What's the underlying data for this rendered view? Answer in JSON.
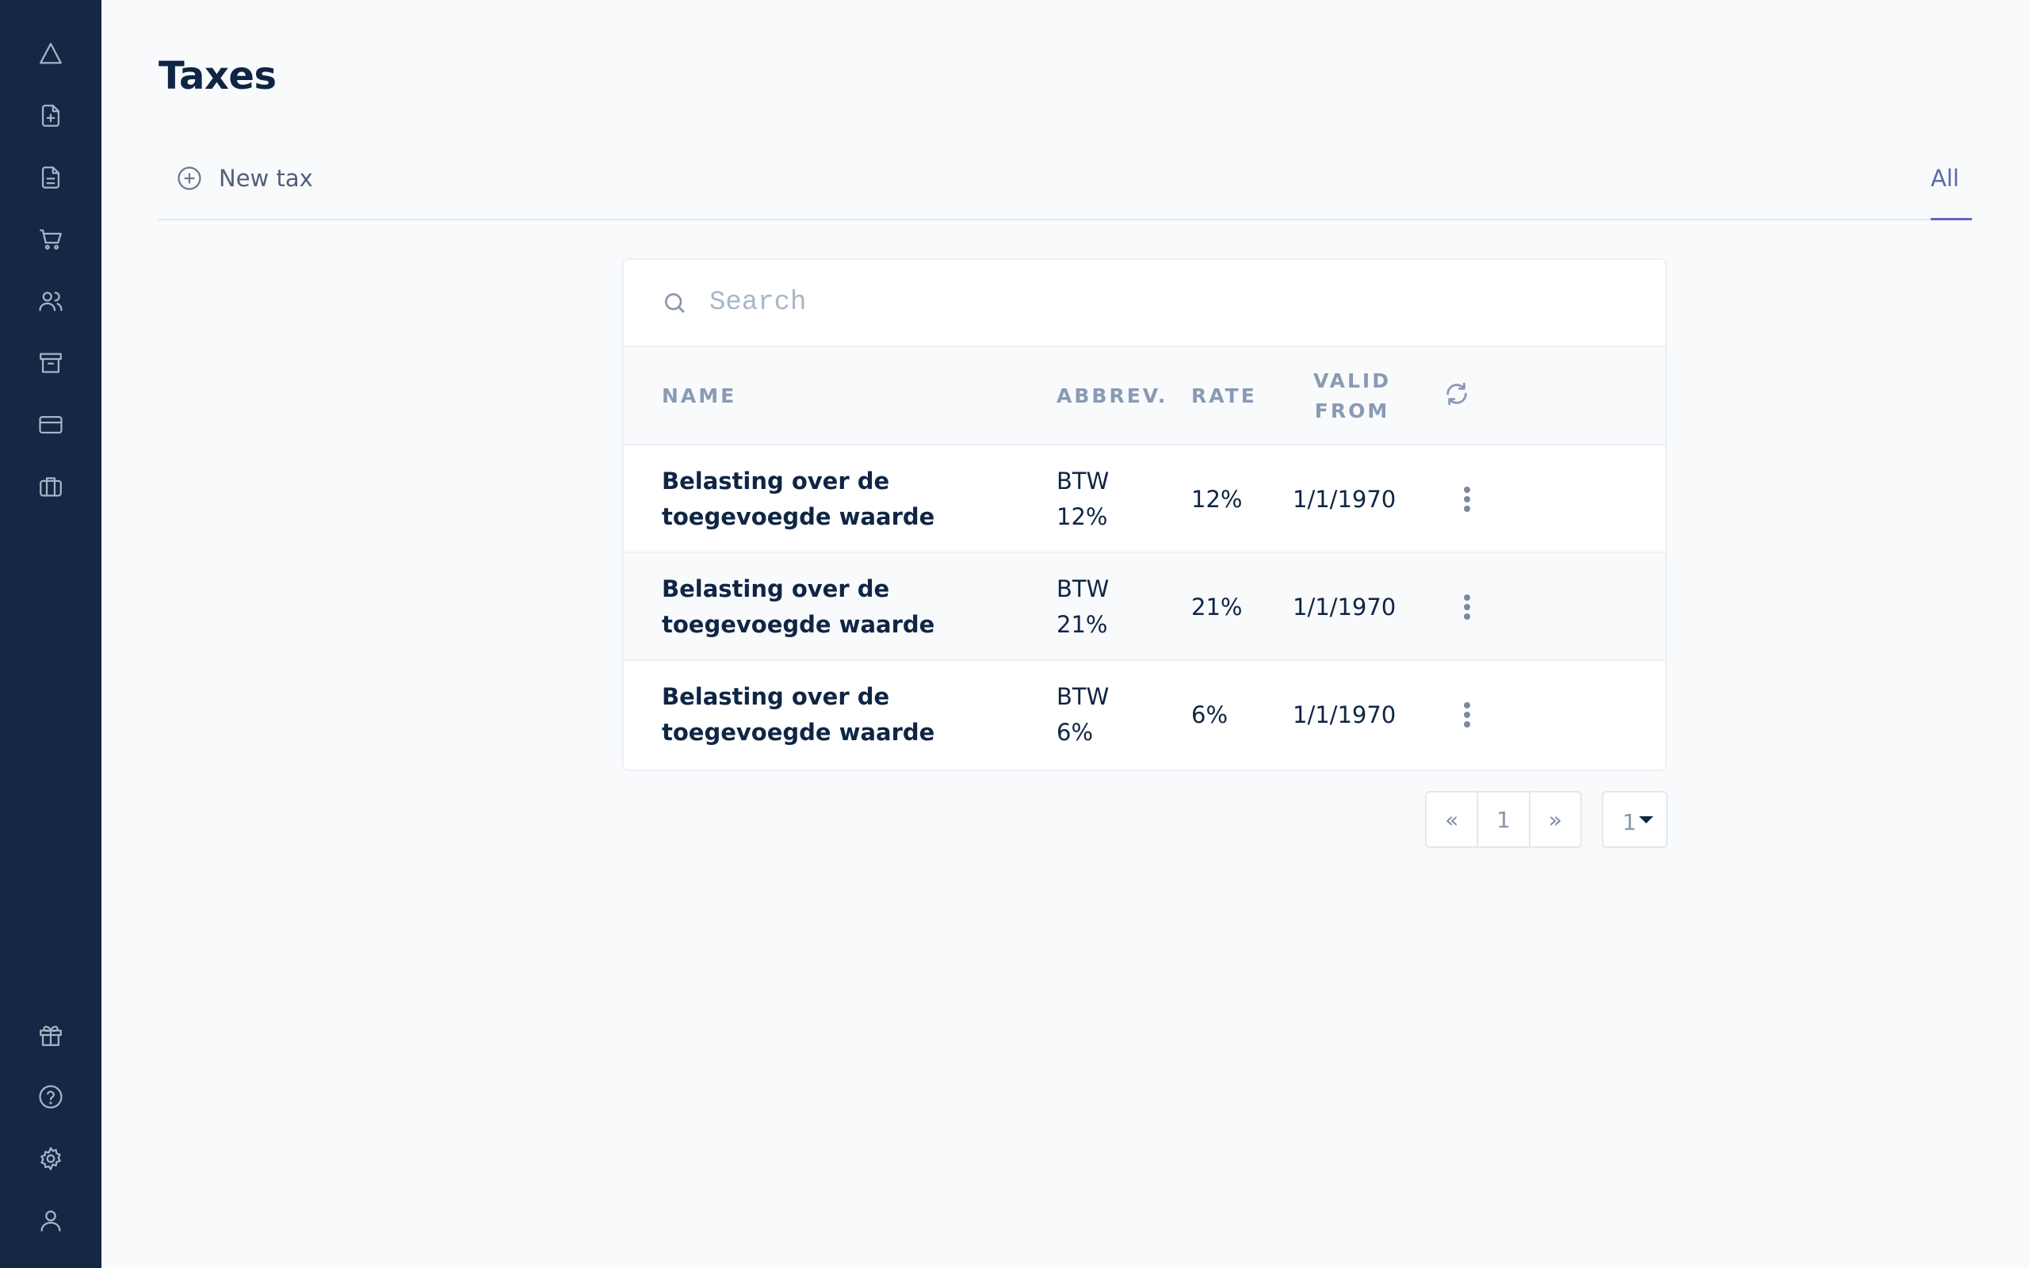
{
  "sidebar": {
    "top_items": [
      {
        "icon": "triangle-logo-icon"
      },
      {
        "icon": "file-plus-icon"
      },
      {
        "icon": "file-icon"
      },
      {
        "icon": "shopping-cart-icon"
      },
      {
        "icon": "users-icon"
      },
      {
        "icon": "archive-icon"
      },
      {
        "icon": "credit-card-icon"
      },
      {
        "icon": "briefcase-icon"
      }
    ],
    "bottom_items": [
      {
        "icon": "gift-icon"
      },
      {
        "icon": "help-circle-icon"
      },
      {
        "icon": "settings-gear-icon"
      },
      {
        "icon": "user-icon"
      }
    ]
  },
  "page": {
    "title": "Taxes"
  },
  "toolbar": {
    "new_label": "New tax",
    "filter_label": "All"
  },
  "search": {
    "placeholder": "Search",
    "value": ""
  },
  "table": {
    "columns": {
      "name": "NAME",
      "abbrev": "ABBREV.",
      "rate": "RATE",
      "valid_line1": "VALID",
      "valid_line2": "FROM"
    },
    "rows": [
      {
        "name": "Belasting over de toegevoegde waarde",
        "abbrev": "BTW 12%",
        "rate": "12%",
        "valid_from": "1/1/1970"
      },
      {
        "name": "Belasting over de toegevoegde waarde",
        "abbrev": "BTW 21%",
        "rate": "21%",
        "valid_from": "1/1/1970"
      },
      {
        "name": "Belasting over de toegevoegde waarde",
        "abbrev": "BTW 6%",
        "rate": "6%",
        "valid_from": "1/1/1970"
      }
    ]
  },
  "pagination": {
    "first": "«",
    "current": "1",
    "last": "»",
    "per_page": "1"
  },
  "colors": {
    "sidebar": "#142744",
    "accent": "#6466c8",
    "text": "#0f2544",
    "muted": "#8a9ab4"
  }
}
